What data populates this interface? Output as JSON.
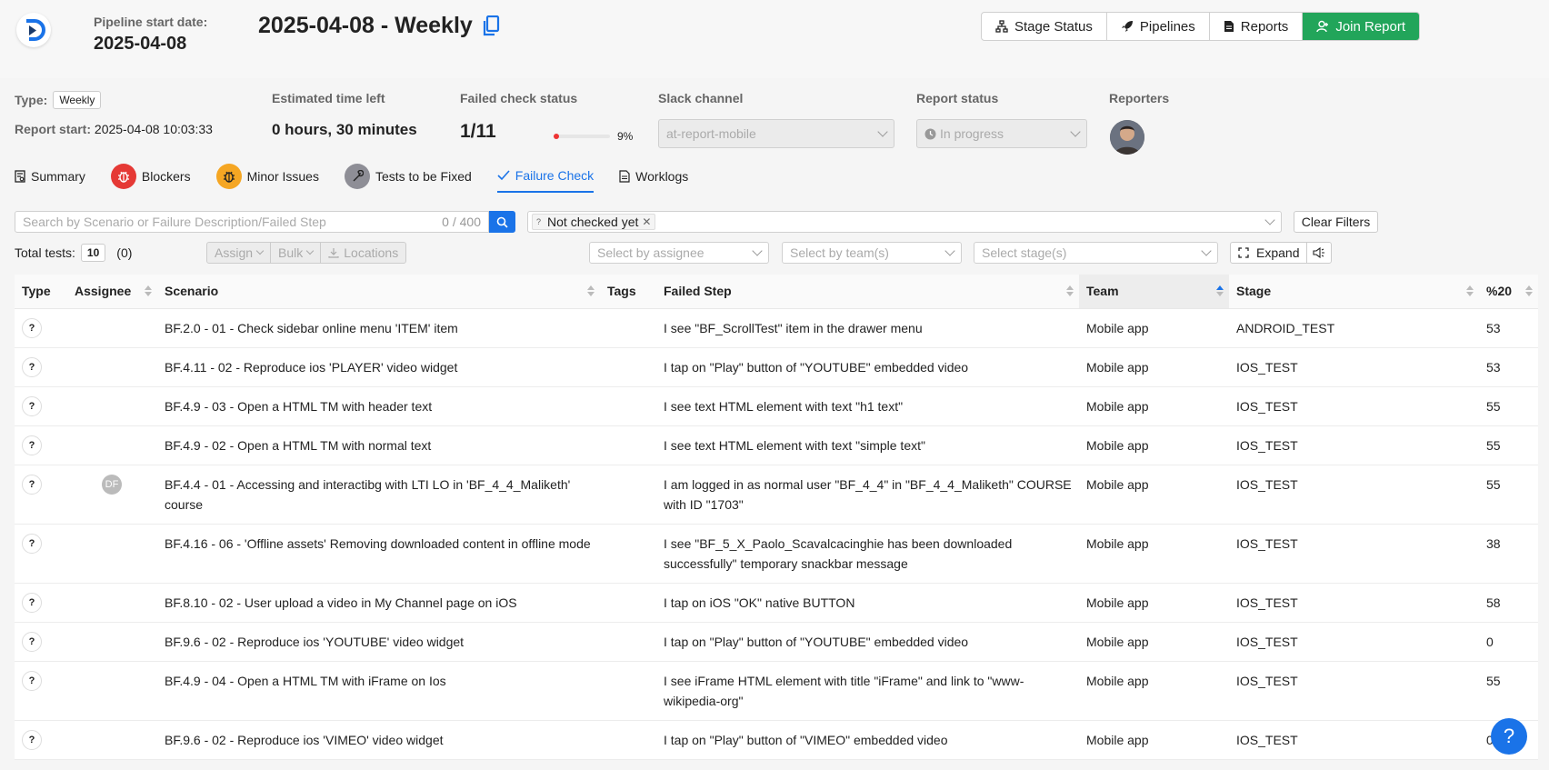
{
  "header": {
    "pipeline_start_label": "Pipeline start date:",
    "pipeline_start_value": "2025-04-08",
    "title": "2025-04-08 - Weekly",
    "buttons": {
      "stage_status": "Stage Status",
      "pipelines": "Pipelines",
      "reports": "Reports",
      "join_report": "Join Report"
    },
    "accent_color": "#22a55a"
  },
  "info": {
    "type_label": "Type:",
    "type_value": "Weekly",
    "report_start_label": "Report start:",
    "report_start_value": "2025-04-08 10:03:33",
    "estimated_label": "Estimated time left",
    "estimated_value": "0 hours, 30 minutes",
    "failed_check_label": "Failed check status",
    "failed_check_value": "1/11",
    "failed_check_percent": "9%",
    "failed_check_fraction": 0.09,
    "slack_label": "Slack channel",
    "slack_value": "at-report-mobile",
    "report_status_label": "Report status",
    "report_status_value": "In progress",
    "reporters_label": "Reporters"
  },
  "tabs": [
    {
      "label": "Summary",
      "icon": "summary-icon"
    },
    {
      "label": "Blockers",
      "icon": "bug-icon",
      "color": "#e53935"
    },
    {
      "label": "Minor Issues",
      "icon": "bug-icon",
      "color": "#f5a623"
    },
    {
      "label": "Tests to be Fixed",
      "icon": "wrench-icon",
      "color": "#8e8e96"
    },
    {
      "label": "Failure Check",
      "icon": "check-icon",
      "active": true
    },
    {
      "label": "Worklogs",
      "icon": "document-icon"
    }
  ],
  "filters": {
    "search_placeholder": "Search by Scenario or Failure Description/Failed Step",
    "search_count": "0 / 400",
    "status_chip": "Not checked yet",
    "clear_filters": "Clear Filters",
    "total_tests_label": "Total tests:",
    "total_tests_value": "10",
    "total_tests_extra": "(0)",
    "assign": "Assign",
    "bulk": "Bulk",
    "locations": "Locations",
    "assignee_placeholder": "Select by assignee",
    "team_placeholder": "Select by team(s)",
    "stage_placeholder": "Select stage(s)",
    "expand": "Expand"
  },
  "table": {
    "columns": [
      "Type",
      "Assignee",
      "Scenario",
      "Tags",
      "Failed Step",
      "Team",
      "Stage",
      "%20"
    ],
    "rows": [
      {
        "type": "?",
        "assignee": "",
        "scenario": "BF.2.0 - 01 - Check sidebar online menu 'ITEM' item",
        "tags": "",
        "failed_step": "I see \"BF_ScrollTest\" item in the drawer menu",
        "team": "Mobile app",
        "stage": "ANDROID_TEST",
        "pct": "53"
      },
      {
        "type": "?",
        "assignee": "",
        "scenario": "BF.4.11 - 02 - Reproduce ios 'PLAYER' video widget",
        "tags": "",
        "failed_step": "I tap on \"Play\" button of \"YOUTUBE\" embedded video",
        "team": "Mobile app",
        "stage": "IOS_TEST",
        "pct": "53"
      },
      {
        "type": "?",
        "assignee": "",
        "scenario": "BF.4.9 - 03 - Open a HTML TM with header text",
        "tags": "",
        "failed_step": "I see text HTML element with text \"h1 text\"",
        "team": "Mobile app",
        "stage": "IOS_TEST",
        "pct": "55"
      },
      {
        "type": "?",
        "assignee": "",
        "scenario": "BF.4.9 - 02 - Open a HTML TM with normal text",
        "tags": "",
        "failed_step": "I see text HTML element with text \"simple text\"",
        "team": "Mobile app",
        "stage": "IOS_TEST",
        "pct": "55"
      },
      {
        "type": "?",
        "assignee": "DF",
        "scenario": "BF.4.4 - 01 - Accessing and interactibg with LTI LO in 'BF_4_4_Maliketh' course",
        "tags": "",
        "failed_step": "I am logged in as normal user \"BF_4_4\" in \"BF_4_4_Maliketh\" COURSE with ID \"1703\"",
        "team": "Mobile app",
        "stage": "IOS_TEST",
        "pct": "55"
      },
      {
        "type": "?",
        "assignee": "",
        "scenario": "BF.4.16 - 06 - 'Offline assets' Removing downloaded content in offline mode",
        "tags": "",
        "failed_step": "I see \"BF_5_X_Paolo_Scavalcacinghie has been downloaded successfully\" temporary snackbar message",
        "team": "Mobile app",
        "stage": "IOS_TEST",
        "pct": "38"
      },
      {
        "type": "?",
        "assignee": "",
        "scenario": "BF.8.10 - 02 - User upload a video in My Channel page on iOS",
        "tags": "",
        "failed_step": "I tap on iOS \"OK\" native BUTTON",
        "team": "Mobile app",
        "stage": "IOS_TEST",
        "pct": "58"
      },
      {
        "type": "?",
        "assignee": "",
        "scenario": "BF.9.6 - 02 - Reproduce ios 'YOUTUBE' video widget",
        "tags": "",
        "failed_step": "I tap on \"Play\" button of \"YOUTUBE\" embedded video",
        "team": "Mobile app",
        "stage": "IOS_TEST",
        "pct": "0"
      },
      {
        "type": "?",
        "assignee": "",
        "scenario": "BF.4.9 - 04 - Open a HTML TM with iFrame on Ios",
        "tags": "",
        "failed_step": "I see iFrame HTML element with title \"iFrame\" and link to \"www-wikipedia-org\"",
        "team": "Mobile app",
        "stage": "IOS_TEST",
        "pct": "55"
      },
      {
        "type": "?",
        "assignee": "",
        "scenario": "BF.9.6 - 02 - Reproduce ios 'VIMEO' video widget",
        "tags": "",
        "failed_step": "I tap on \"Play\" button of \"VIMEO\" embedded video",
        "team": "Mobile app",
        "stage": "IOS_TEST",
        "pct": "0"
      }
    ]
  },
  "help_label": "?"
}
